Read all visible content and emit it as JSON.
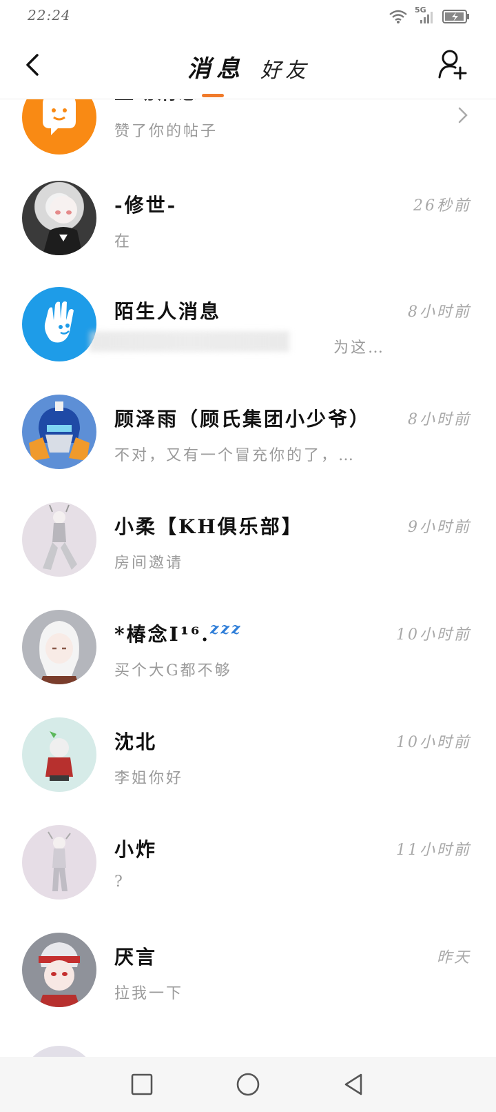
{
  "status": {
    "time": "22:24",
    "network": "5G",
    "icons": [
      "wifi-icon",
      "signal-icon",
      "battery-charging-icon"
    ]
  },
  "header": {
    "tab_active": "消息",
    "tab_inactive": "好友",
    "back_icon": "back-arrow-icon",
    "add_icon": "add-friend-icon",
    "accent": "#f07a2a"
  },
  "items": [
    {
      "name": "互动消息",
      "preview": "赞了你的帖子",
      "time": ""
    },
    {
      "name": "-修世-",
      "preview": "在",
      "time": "26秒前"
    },
    {
      "name": "陌生人消息",
      "preview": "为这…",
      "time": "8小时前"
    },
    {
      "name": "顾泽雨（顾氏集团小少爷）",
      "preview": "不对，又有一个冒充你的了，…",
      "time": "8小时前"
    },
    {
      "name": "小柔【KH俱乐部】",
      "preview": "房间邀请",
      "time": "9小时前"
    },
    {
      "name": "*椿念I¹⁶.",
      "name_suffix": "zzz",
      "preview": "买个大G都不够",
      "time": "10小时前"
    },
    {
      "name": "沈北",
      "preview": "李姐你好",
      "time": "10小时前"
    },
    {
      "name": "小炸",
      "preview": "?",
      "time": "11小时前"
    },
    {
      "name": "厌言",
      "preview": "拉我一下",
      "time": "昨天"
    }
  ],
  "navbar": {
    "icons": [
      "square-recent-icon",
      "circle-home-icon",
      "triangle-back-icon"
    ]
  }
}
